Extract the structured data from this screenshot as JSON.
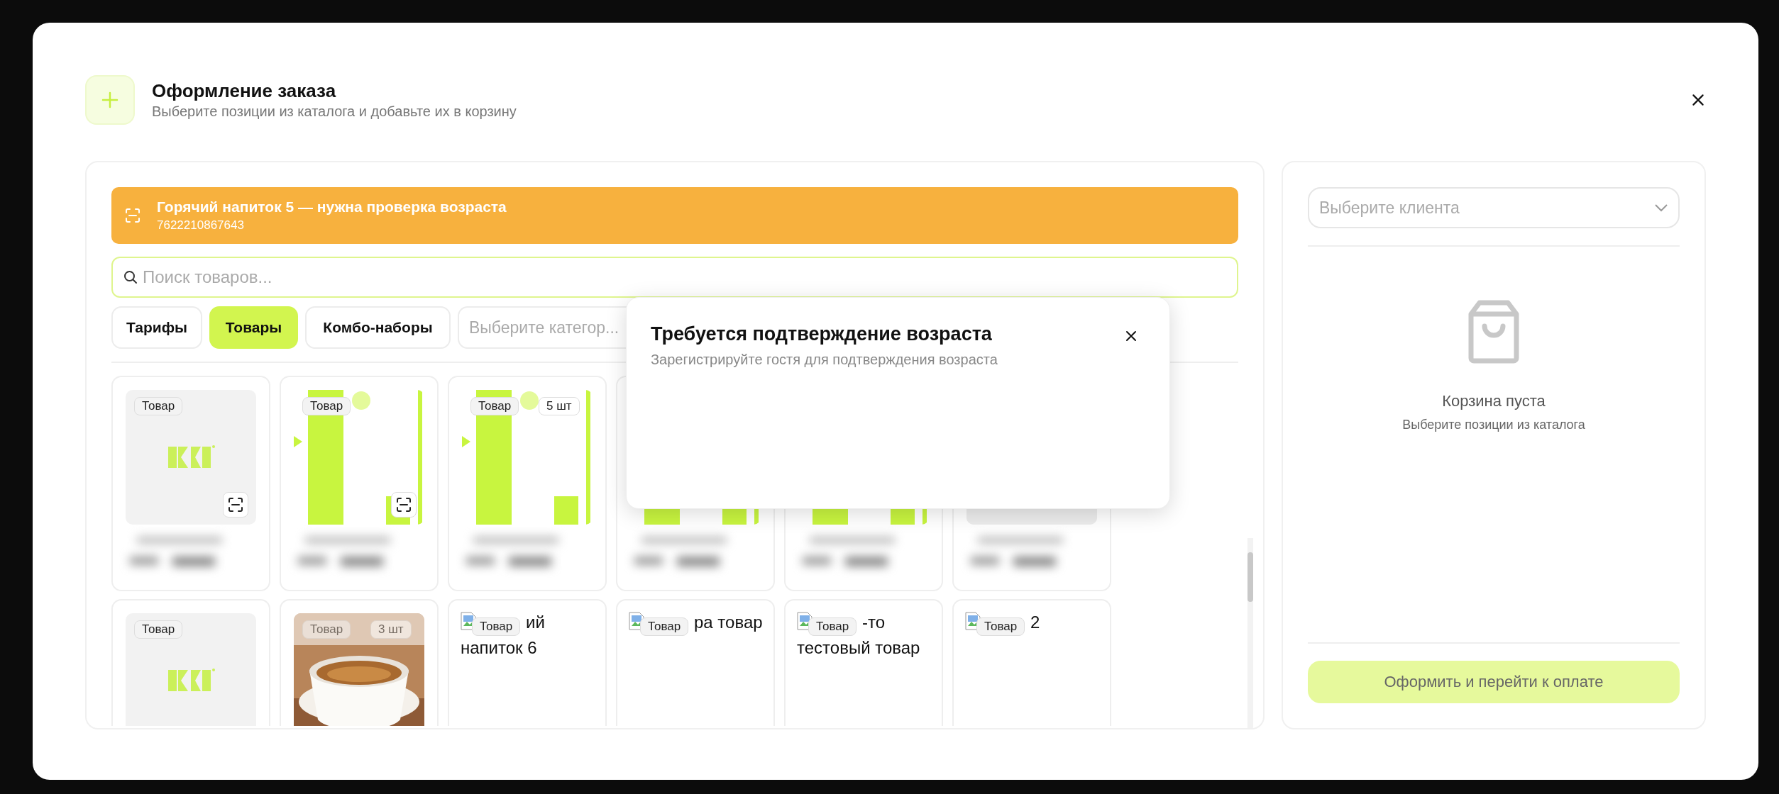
{
  "header": {
    "title": "Оформление заказа",
    "subtitle": "Выберите позиции из каталога и добавьте их в корзину"
  },
  "banner": {
    "title": "Горячий напиток 5 — нужна проверка возраста",
    "code": "7622210867643"
  },
  "search": {
    "placeholder": "Поиск товаров..."
  },
  "tabs": [
    {
      "label": "Тарифы",
      "selected": false
    },
    {
      "label": "Товары",
      "selected": true
    },
    {
      "label": "Комбо-наборы",
      "selected": false
    }
  ],
  "category": {
    "placeholder": "Выберите категор..."
  },
  "cards": [
    [
      {
        "kind": "logo",
        "badge": "Товар",
        "scan": true,
        "blurred": true
      },
      {
        "kind": "bars",
        "badge": "Товар",
        "scan": true,
        "blurred": true
      },
      {
        "kind": "bars",
        "badge": "Товар",
        "count": "5 шт",
        "blurred": true
      },
      {
        "kind": "bars",
        "blurred": true
      },
      {
        "kind": "bars",
        "blurred": true
      },
      {
        "kind": "plain",
        "blurred": true
      }
    ],
    [
      {
        "kind": "logo",
        "badge": "Товар"
      },
      {
        "badge": "Товар",
        "count": "3 шт"
      },
      {
        "kind": "broken",
        "badge": "Товар",
        "alt": [
          "ий",
          "напиток 6"
        ]
      },
      {
        "kind": "broken",
        "badge": "Товар",
        "alt": [
          "ра товар"
        ]
      },
      {
        "kind": "broken",
        "badge": "Товар",
        "alt": [
          "-то",
          "тестовый товар"
        ]
      },
      {
        "kind": "broken",
        "badge": "Товар",
        "alt": [
          "2"
        ]
      }
    ]
  ],
  "popup": {
    "title": "Требуется подтверждение возраста",
    "subtitle": "Зарегистрируйте гостя для подтверждения возраста"
  },
  "cart": {
    "client_placeholder": "Выберите клиента",
    "empty_title": "Корзина пуста",
    "empty_subtitle": "Выберите позиции из каталога",
    "checkout": "Оформить и перейти к оплате"
  }
}
